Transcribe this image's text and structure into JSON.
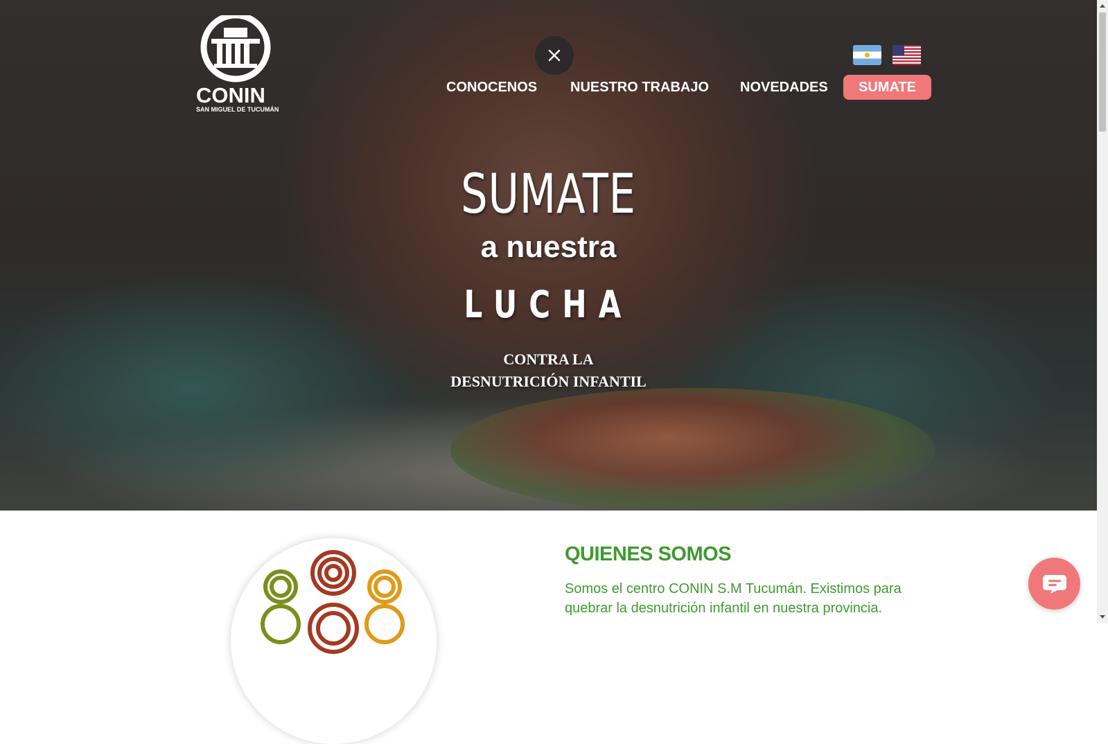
{
  "logo": {
    "name": "CONIN",
    "subtitle": "SAN MIGUEL DE TUCUMÁN",
    "icon": "conin-logo-icon"
  },
  "header": {
    "close_icon": "close-icon",
    "flags": [
      {
        "name": "argentina-flag-icon"
      },
      {
        "name": "usa-flag-icon"
      }
    ],
    "nav": [
      {
        "label": "CONOCENOS"
      },
      {
        "label": "NUESTRO TRABAJO"
      },
      {
        "label": "NOVEDADES"
      },
      {
        "label": "SUMATE"
      }
    ]
  },
  "hero": {
    "line1": "SUMATE",
    "line2": "a nuestra",
    "line3": "LUCHA",
    "line4a": "CONTRA LA",
    "line4b": "DESNUTRICIÓN INFANTIL"
  },
  "about": {
    "title": "QUIENES SOMOS",
    "text": "Somos el centro CONIN S.M Tucumán. Existimos para quebrar la desnutrición infantil en nuestra provincia."
  },
  "chat": {
    "icon": "chat-bubble-icon"
  },
  "colors": {
    "accent": "#f1787a",
    "green": "#3f9a2e"
  }
}
